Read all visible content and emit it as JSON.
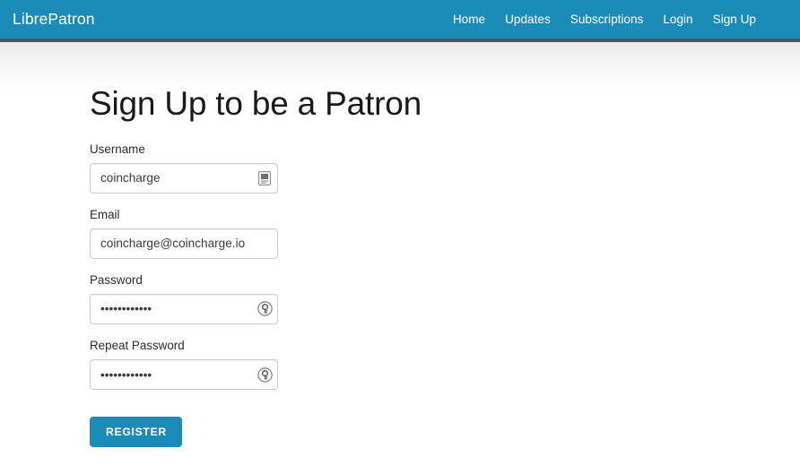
{
  "navbar": {
    "brand": "LibrePatron",
    "brand_color": "#ffffff",
    "background_color": "#1b8cb8",
    "border_color": "#50555a",
    "links": [
      {
        "label": "Home",
        "name": "nav-link-home"
      },
      {
        "label": "Updates",
        "name": "nav-link-updates"
      },
      {
        "label": "Subscriptions",
        "name": "nav-link-subscriptions"
      },
      {
        "label": "Login",
        "name": "nav-link-login"
      },
      {
        "label": "Sign Up",
        "name": "nav-link-signup"
      }
    ]
  },
  "main": {
    "title": "Sign Up to be a Patron",
    "form": {
      "username": {
        "label": "Username",
        "value": "coincharge",
        "placeholder": "",
        "icon": "contact-card-icon"
      },
      "email": {
        "label": "Email",
        "value": "coincharge@coincharge.io",
        "placeholder": ""
      },
      "password": {
        "label": "Password",
        "value": "••••••••••••",
        "placeholder": "",
        "icon": "key-circle-icon"
      },
      "repeat_password": {
        "label": "Repeat Password",
        "value": "••••••••••••",
        "placeholder": "",
        "icon": "key-circle-icon"
      },
      "submit_label": "Register",
      "submit_color": "#1b8cb8"
    }
  }
}
